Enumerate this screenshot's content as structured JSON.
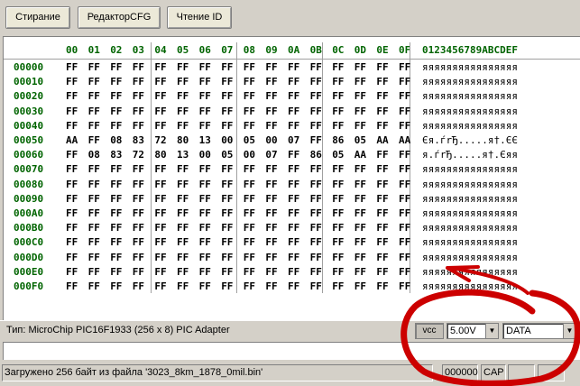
{
  "toolbar": {
    "erase_label": "Стирание",
    "cfg_editor_label": "РедакторCFG",
    "read_id_label": "Чтение ID"
  },
  "hex": {
    "header_cols": [
      "00",
      "01",
      "02",
      "03",
      "04",
      "05",
      "06",
      "07",
      "08",
      "09",
      "0A",
      "0B",
      "0C",
      "0D",
      "0E",
      "0F"
    ],
    "ascii_header": "0123456789ABCDEF",
    "rows": [
      {
        "addr": "00000",
        "bytes": [
          "FF",
          "FF",
          "FF",
          "FF",
          "FF",
          "FF",
          "FF",
          "FF",
          "FF",
          "FF",
          "FF",
          "FF",
          "FF",
          "FF",
          "FF",
          "FF"
        ],
        "ascii": "яяяяяяяяяяяяяяяя"
      },
      {
        "addr": "00010",
        "bytes": [
          "FF",
          "FF",
          "FF",
          "FF",
          "FF",
          "FF",
          "FF",
          "FF",
          "FF",
          "FF",
          "FF",
          "FF",
          "FF",
          "FF",
          "FF",
          "FF"
        ],
        "ascii": "яяяяяяяяяяяяяяяя"
      },
      {
        "addr": "00020",
        "bytes": [
          "FF",
          "FF",
          "FF",
          "FF",
          "FF",
          "FF",
          "FF",
          "FF",
          "FF",
          "FF",
          "FF",
          "FF",
          "FF",
          "FF",
          "FF",
          "FF"
        ],
        "ascii": "яяяяяяяяяяяяяяяя"
      },
      {
        "addr": "00030",
        "bytes": [
          "FF",
          "FF",
          "FF",
          "FF",
          "FF",
          "FF",
          "FF",
          "FF",
          "FF",
          "FF",
          "FF",
          "FF",
          "FF",
          "FF",
          "FF",
          "FF"
        ],
        "ascii": "яяяяяяяяяяяяяяяя"
      },
      {
        "addr": "00040",
        "bytes": [
          "FF",
          "FF",
          "FF",
          "FF",
          "FF",
          "FF",
          "FF",
          "FF",
          "FF",
          "FF",
          "FF",
          "FF",
          "FF",
          "FF",
          "FF",
          "FF"
        ],
        "ascii": "яяяяяяяяяяяяяяяя"
      },
      {
        "addr": "00050",
        "bytes": [
          "AA",
          "FF",
          "08",
          "83",
          "72",
          "80",
          "13",
          "00",
          "05",
          "00",
          "07",
          "FF",
          "86",
          "05",
          "AA",
          "AA"
        ],
        "ascii": "Єя.ѓrЂ.....я†.ЄЄ"
      },
      {
        "addr": "00060",
        "bytes": [
          "FF",
          "08",
          "83",
          "72",
          "80",
          "13",
          "00",
          "05",
          "00",
          "07",
          "FF",
          "86",
          "05",
          "AA",
          "FF",
          "FF"
        ],
        "ascii": "я.ѓrЂ.....я†.Єяя"
      },
      {
        "addr": "00070",
        "bytes": [
          "FF",
          "FF",
          "FF",
          "FF",
          "FF",
          "FF",
          "FF",
          "FF",
          "FF",
          "FF",
          "FF",
          "FF",
          "FF",
          "FF",
          "FF",
          "FF"
        ],
        "ascii": "яяяяяяяяяяяяяяяя"
      },
      {
        "addr": "00080",
        "bytes": [
          "FF",
          "FF",
          "FF",
          "FF",
          "FF",
          "FF",
          "FF",
          "FF",
          "FF",
          "FF",
          "FF",
          "FF",
          "FF",
          "FF",
          "FF",
          "FF"
        ],
        "ascii": "яяяяяяяяяяяяяяяя"
      },
      {
        "addr": "00090",
        "bytes": [
          "FF",
          "FF",
          "FF",
          "FF",
          "FF",
          "FF",
          "FF",
          "FF",
          "FF",
          "FF",
          "FF",
          "FF",
          "FF",
          "FF",
          "FF",
          "FF"
        ],
        "ascii": "яяяяяяяяяяяяяяяя"
      },
      {
        "addr": "000A0",
        "bytes": [
          "FF",
          "FF",
          "FF",
          "FF",
          "FF",
          "FF",
          "FF",
          "FF",
          "FF",
          "FF",
          "FF",
          "FF",
          "FF",
          "FF",
          "FF",
          "FF"
        ],
        "ascii": "яяяяяяяяяяяяяяяя"
      },
      {
        "addr": "000B0",
        "bytes": [
          "FF",
          "FF",
          "FF",
          "FF",
          "FF",
          "FF",
          "FF",
          "FF",
          "FF",
          "FF",
          "FF",
          "FF",
          "FF",
          "FF",
          "FF",
          "FF"
        ],
        "ascii": "яяяяяяяяяяяяяяяя"
      },
      {
        "addr": "000C0",
        "bytes": [
          "FF",
          "FF",
          "FF",
          "FF",
          "FF",
          "FF",
          "FF",
          "FF",
          "FF",
          "FF",
          "FF",
          "FF",
          "FF",
          "FF",
          "FF",
          "FF"
        ],
        "ascii": "яяяяяяяяяяяяяяяя"
      },
      {
        "addr": "000D0",
        "bytes": [
          "FF",
          "FF",
          "FF",
          "FF",
          "FF",
          "FF",
          "FF",
          "FF",
          "FF",
          "FF",
          "FF",
          "FF",
          "FF",
          "FF",
          "FF",
          "FF"
        ],
        "ascii": "яяяяяяяяяяяяяяяя"
      },
      {
        "addr": "000E0",
        "bytes": [
          "FF",
          "FF",
          "FF",
          "FF",
          "FF",
          "FF",
          "FF",
          "FF",
          "FF",
          "FF",
          "FF",
          "FF",
          "FF",
          "FF",
          "FF",
          "FF"
        ],
        "ascii": "яяяяяяяяяяяяяяяя"
      },
      {
        "addr": "000F0",
        "bytes": [
          "FF",
          "FF",
          "FF",
          "FF",
          "FF",
          "FF",
          "FF",
          "FF",
          "FF",
          "FF",
          "FF",
          "FF",
          "FF",
          "FF",
          "FF",
          "FF"
        ],
        "ascii": "яяяяяяяяяяяяяяяя"
      }
    ]
  },
  "info": {
    "chip_type": "Тип: MicroChip PIC16F1933 (256 x 8)   PIC Adapter",
    "vcc_label": "vcc",
    "voltage_value": "5.00V",
    "mode_value": "DATA"
  },
  "status": {
    "message": "Загружено 256  байт из файла '3023_8km_1878_0mil.bin'",
    "position": "000000",
    "cap": "CAP"
  },
  "colors": {
    "header_green": "#006400",
    "annotation_red": "#cc0000"
  }
}
